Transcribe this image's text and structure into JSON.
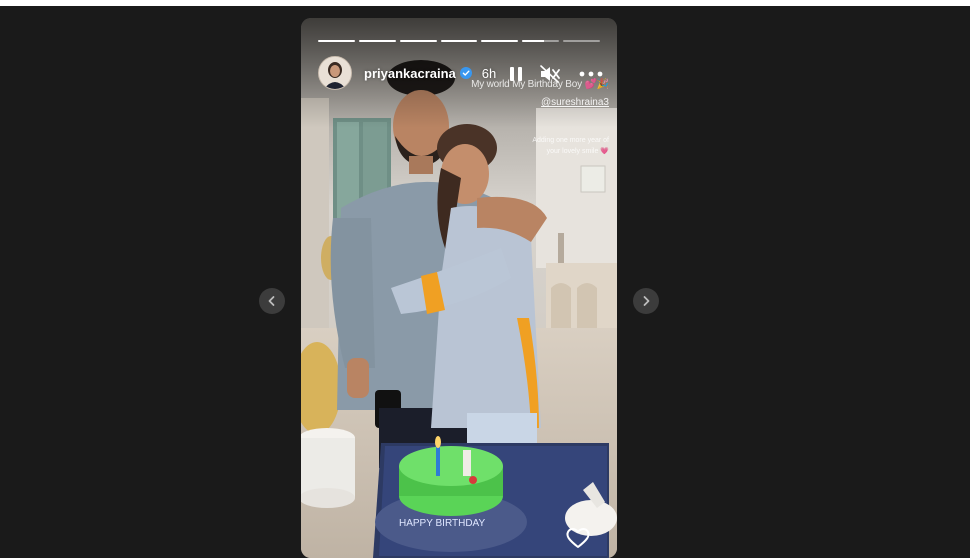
{
  "story": {
    "username": "priyankacraina",
    "time_ago": "6h",
    "caption_line1": "My world My Birthday Boy 💕🎉",
    "mention": "@sureshraina3",
    "caption_line2_a": "Adding one more year of",
    "caption_line2_b": "your lovely smile 💗",
    "cake_text": "HAPPY BIRTHDAY",
    "progress": {
      "segments": 7,
      "completed": 5,
      "current_fraction": 0.6
    }
  },
  "icons": {
    "prev": "chevron-left-icon",
    "next": "chevron-right-icon",
    "verified": "verified-badge-icon",
    "pause": "pause-icon",
    "mute": "speaker-muted-icon",
    "more": "more-dots-icon",
    "like": "heart-icon"
  },
  "colors": {
    "page_bg": "#1a1a1a",
    "verified": "#3897f0",
    "cake": "#4cc24a",
    "sleeve_accent": "#f0a023"
  }
}
